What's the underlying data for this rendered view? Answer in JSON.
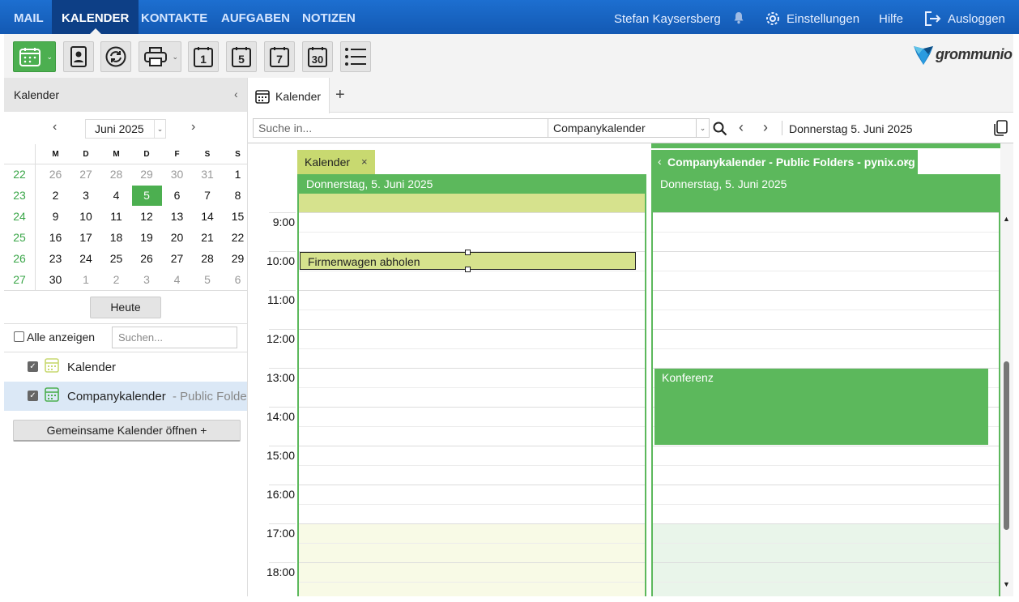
{
  "nav": {
    "tabs": [
      "MAIL",
      "KALENDER",
      "KONTAKTE",
      "AUFGABEN",
      "NOTIZEN"
    ],
    "user": "Stefan Kaysersberg",
    "settings": "Einstellungen",
    "help": "Hilfe",
    "logout": "Ausloggen"
  },
  "toolbar": {
    "day_1": "1",
    "day_5": "5",
    "day_7": "7",
    "day_30": "30",
    "logo_text": "grommunio"
  },
  "sidebar": {
    "title": "Kalender",
    "month_label": "Juni 2025",
    "weekday_headers": [
      "M",
      "D",
      "M",
      "D",
      "F",
      "S",
      "S"
    ],
    "weeks": [
      {
        "wk": "22",
        "days": [
          "26",
          "27",
          "28",
          "29",
          "30",
          "31",
          "1"
        ]
      },
      {
        "wk": "23",
        "days": [
          "2",
          "3",
          "4",
          "5",
          "6",
          "7",
          "8"
        ]
      },
      {
        "wk": "24",
        "days": [
          "9",
          "10",
          "11",
          "12",
          "13",
          "14",
          "15"
        ]
      },
      {
        "wk": "25",
        "days": [
          "16",
          "17",
          "18",
          "19",
          "20",
          "21",
          "22"
        ]
      },
      {
        "wk": "26",
        "days": [
          "23",
          "24",
          "25",
          "26",
          "27",
          "28",
          "29"
        ]
      },
      {
        "wk": "27",
        "days": [
          "30",
          "1",
          "2",
          "3",
          "4",
          "5",
          "6"
        ]
      }
    ],
    "today_button": "Heute",
    "show_all_label": "Alle anzeigen",
    "search_placeholder": "Suchen...",
    "calendars": [
      {
        "name": "Kalender",
        "sub": "",
        "color": "#c8d970"
      },
      {
        "name": "Companykalender",
        "sub": "- Public Folder",
        "color": "#4caf50"
      }
    ],
    "open_shared": "Gemeinsame Kalender öffnen +"
  },
  "main": {
    "tab_label": "Kalender",
    "search_placeholder": "Suche in...",
    "search_scope": "Companykalender",
    "current_date": "Donnerstag 5. Juni 2025",
    "hours": [
      "9:00",
      "10:00",
      "11:00",
      "12:00",
      "13:00",
      "14:00",
      "15:00",
      "16:00",
      "17:00",
      "18:00"
    ],
    "columns": [
      {
        "tab": "Kalender",
        "date": "Donnerstag, 5. Juni 2025",
        "color": "#c8d970"
      },
      {
        "tab": "Companykalender - Public Folders - pynix.org",
        "date": "Donnerstag, 5. Juni 2025",
        "color": "#5cb85c"
      }
    ],
    "events": [
      {
        "title": "Firmenwagen abholen",
        "column": 0,
        "start": "10:00",
        "end": "10:30"
      },
      {
        "title": "Konferenz",
        "column": 1,
        "start": "13:00",
        "end": "15:00"
      }
    ]
  }
}
